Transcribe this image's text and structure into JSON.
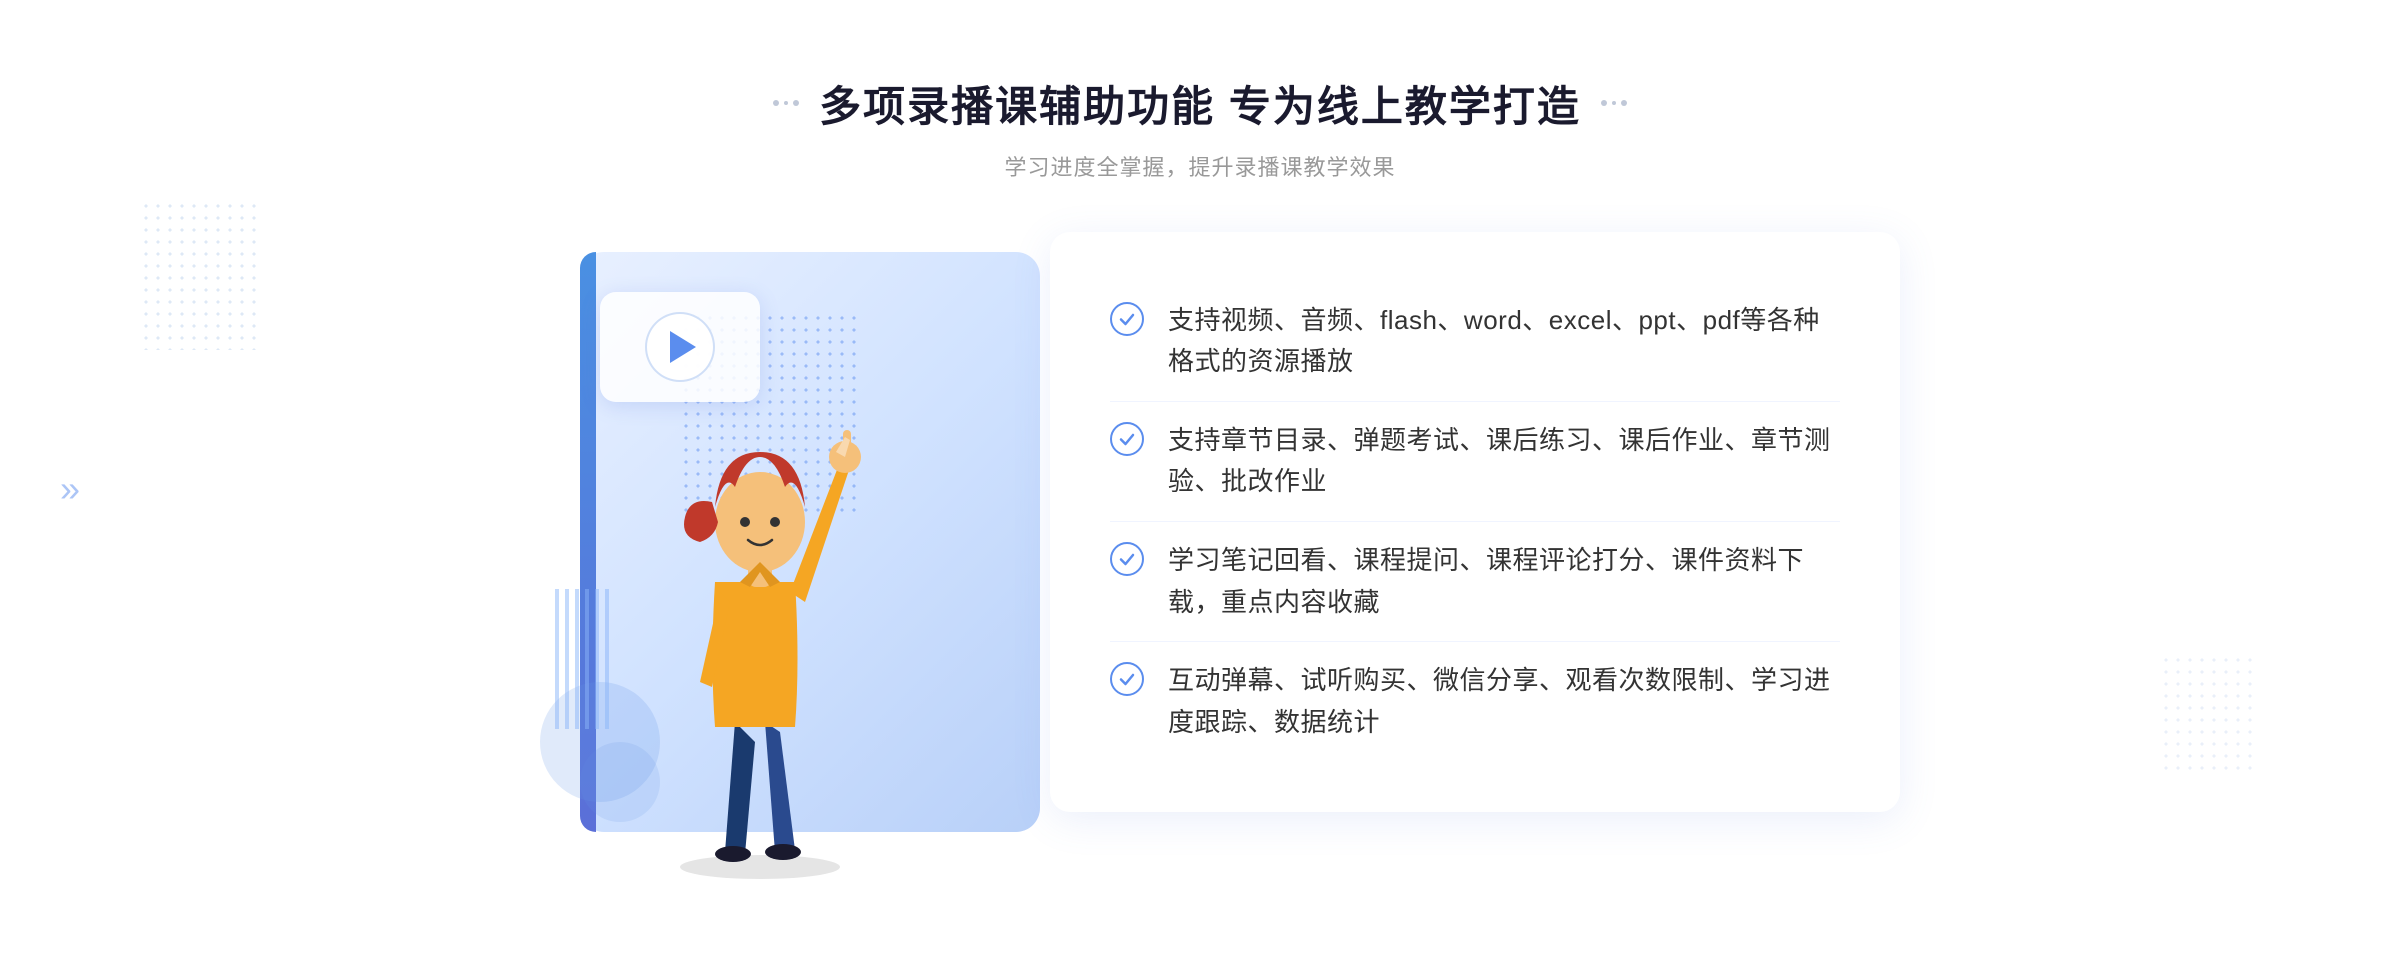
{
  "header": {
    "title": "多项录播课辅助功能 专为线上教学打造",
    "subtitle": "学习进度全掌握，提升录播课教学效果"
  },
  "features": [
    {
      "id": 1,
      "text": "支持视频、音频、flash、word、excel、ppt、pdf等各种格式的资源播放"
    },
    {
      "id": 2,
      "text": "支持章节目录、弹题考试、课后练习、课后作业、章节测验、批改作业"
    },
    {
      "id": 3,
      "text": "学习笔记回看、课程提问、课程评论打分、课件资料下载，重点内容收藏"
    },
    {
      "id": 4,
      "text": "互动弹幕、试听购买、微信分享、观看次数限制、学习进度跟踪、数据统计"
    }
  ],
  "decorations": {
    "chevrons": "»",
    "checkmark": "✓"
  }
}
